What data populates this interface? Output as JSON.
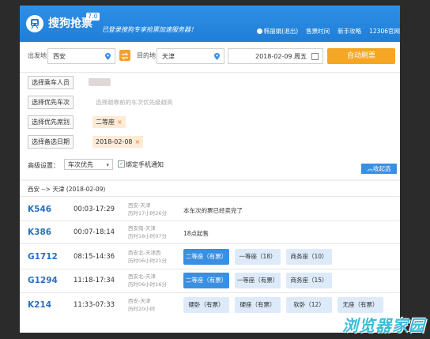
{
  "header": {
    "app_title": "搜狗抢票",
    "version": "7.0",
    "slogan": "已登录搜狗专享抢票加速服务器！",
    "user_label": "韩丽娟(退出)",
    "nav": [
      "售票时间",
      "新手攻略",
      "12306官网"
    ],
    "accent": "#1f7fd8"
  },
  "search": {
    "from_label": "出发地",
    "from_value": "西安",
    "to_label": "目的地",
    "to_value": "天津",
    "date_value": "2018-02-09  周五",
    "refresh_label": "自动刷票"
  },
  "options": {
    "passenger_btn": "选择乘车人员",
    "train_btn": "选择优先车次",
    "train_hint": "选择越靠前的车次优先级越高",
    "seat_btn": "选择优先席别",
    "seat_tag": "二等座",
    "date_btn": "选择备选日期",
    "date_tag": "2018-02-08",
    "advanced_label": "高级设置：",
    "priority_select": "车次优先",
    "notify_label": "绑定手机通知",
    "collapse_label": "收起选"
  },
  "results": {
    "route": "西安 --> 天津 (2018-02-09)",
    "trains": [
      {
        "num": "K546",
        "time": "00:03-17:29",
        "stations": "西安-天津",
        "duration": "历时17小时26分",
        "note": "本车次的票已经卖完了",
        "seats": []
      },
      {
        "num": "K386",
        "time": "00:07-18:14",
        "stations": "西安南-天津",
        "duration": "历时18小时07分",
        "note": "18点起售",
        "seats": []
      },
      {
        "num": "G1712",
        "time": "08:15-14:36",
        "stations": "西安北-天津西",
        "duration": "历时06小时21分",
        "note": "",
        "seats": [
          {
            "label": "二等座（有票）",
            "on": true
          },
          {
            "label": "一等座（18）",
            "on": false
          },
          {
            "label": "商务座（10）",
            "on": false
          }
        ]
      },
      {
        "num": "G1294",
        "time": "11:18-17:34",
        "stations": "西安北-天津",
        "duration": "历时06小时16分",
        "note": "",
        "seats": [
          {
            "label": "二等座（有票）",
            "on": true
          },
          {
            "label": "一等座（有票）",
            "on": false
          },
          {
            "label": "商务座（15）",
            "on": false
          }
        ]
      },
      {
        "num": "K214",
        "time": "11:33-07:33",
        "stations": "西安-天津",
        "duration": "历时20小时",
        "note": "",
        "seats": [
          {
            "label": "硬卧（有票）",
            "on": false
          },
          {
            "label": "硬座（有票）",
            "on": false
          },
          {
            "label": "软卧（12）",
            "on": false
          },
          {
            "label": "无座（有票）",
            "on": false
          }
        ]
      }
    ]
  },
  "watermark": "浏览器家园"
}
